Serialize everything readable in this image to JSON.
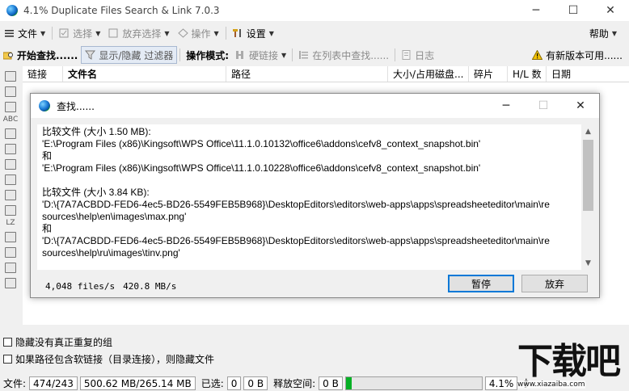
{
  "window": {
    "title": "4.1% Duplicate Files Search & Link 7.0.3",
    "minimize": "─",
    "maximize": "☐",
    "close": "✕"
  },
  "menu": {
    "file": "文件",
    "select": "选择",
    "deselect": "放弃选择",
    "operate": "操作",
    "settings": "设置",
    "help": "帮助"
  },
  "toolbar": {
    "start_search": "开始查找......",
    "toggle_filter": "显示/隐藏 过滤器",
    "mode_label": "操作模式:",
    "hard_link": "硬链接",
    "find_in_list": "在列表中查找......",
    "log": "日志",
    "new_version": "有新版本可用......"
  },
  "columns": [
    "链接",
    "文件名",
    "路径",
    "大小/占用磁盘...",
    "碎片",
    "H/L 数",
    "日期"
  ],
  "sidebar": {
    "abc_label": "ABC",
    "lz_label": "LZ"
  },
  "dialog": {
    "title": "查找......",
    "minimize": "─",
    "maximize": "☐",
    "close": "✕",
    "lines": [
      "比较文件 (大小 1.50 MB):",
      "'E:\\Program Files (x86)\\Kingsoft\\WPS Office\\11.1.0.10132\\office6\\addons\\cefv8_context_snapshot.bin'",
      "和",
      "'E:\\Program Files (x86)\\Kingsoft\\WPS Office\\11.1.0.10228\\office6\\addons\\cefv8_context_snapshot.bin'",
      "",
      "比较文件 (大小 3.84 KB):",
      "'D:\\{7A7ACBDD-FED6-4ec5-BD26-5549FEB5B968}\\DesktopEditors\\editors\\web-apps\\apps\\spreadsheeteditor\\main\\re",
      "sources\\help\\en\\images\\max.png'",
      "和",
      "'D:\\{7A7ACBDD-FED6-4ec5-BD26-5549FEB5B968}\\DesktopEditors\\editors\\web-apps\\apps\\spreadsheeteditor\\main\\re",
      "sources\\help\\ru\\images\\tinv.png'"
    ],
    "files_rate": "4,048 files/s",
    "byte_rate": "420.8 MB/s",
    "pause_button": "暂停",
    "abort_button": "放弃"
  },
  "options": {
    "hide_non_dup": "隐藏没有真正重复的组",
    "hide_softlink": "如果路径包含软链接（目录连接），则隐藏文件"
  },
  "status": {
    "files_label": "文件:",
    "files_count": "474/243",
    "size": "500.62 MB/265.14 MB",
    "selected_label": "已选:",
    "selected_count": "0",
    "selected_size": "0 B",
    "free_label": "释放空间:",
    "free_value": "0 B",
    "progress_percent": "4.1%",
    "progress_fraction": 0.041,
    "trailing": "扌"
  },
  "watermark": {
    "big": "下载吧",
    "small": "www.xiazaiba.com"
  },
  "colors": {
    "progress_green": "#06b025",
    "accent_blue": "#0078d7"
  }
}
